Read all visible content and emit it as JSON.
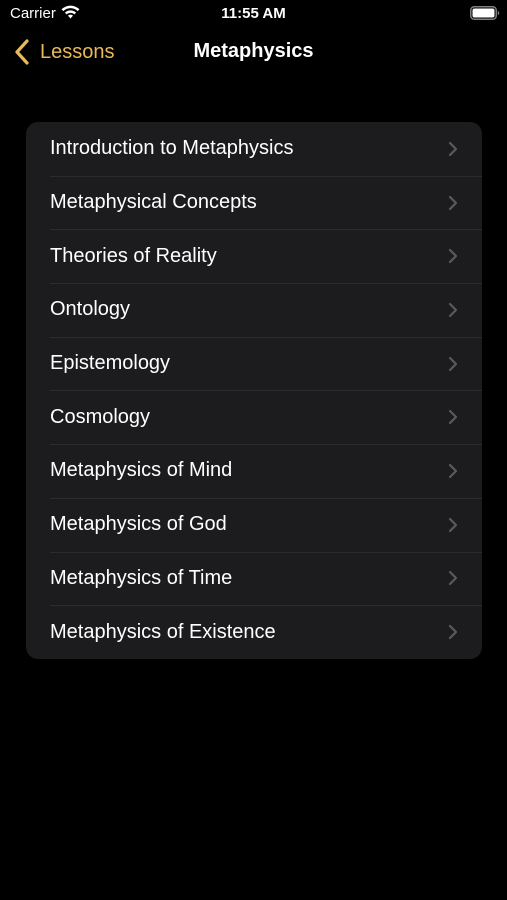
{
  "status_bar": {
    "carrier": "Carrier",
    "time": "11:55 AM",
    "wifi_icon": "wifi-icon",
    "battery_icon": "battery-icon"
  },
  "nav": {
    "back_label": "Lessons",
    "title": "Metaphysics",
    "accent_color": "#e8b95a"
  },
  "lessons": {
    "items": [
      {
        "label": "Introduction to Metaphysics"
      },
      {
        "label": "Metaphysical Concepts"
      },
      {
        "label": "Theories of Reality"
      },
      {
        "label": "Ontology"
      },
      {
        "label": "Epistemology"
      },
      {
        "label": "Cosmology"
      },
      {
        "label": "Metaphysics of Mind"
      },
      {
        "label": "Metaphysics of God"
      },
      {
        "label": "Metaphysics of Time"
      },
      {
        "label": "Metaphysics of Existence"
      }
    ]
  },
  "colors": {
    "background": "#000000",
    "list_background": "#1c1c1e",
    "separator": "#2c2c2e",
    "chevron": "#5a5a5e"
  }
}
